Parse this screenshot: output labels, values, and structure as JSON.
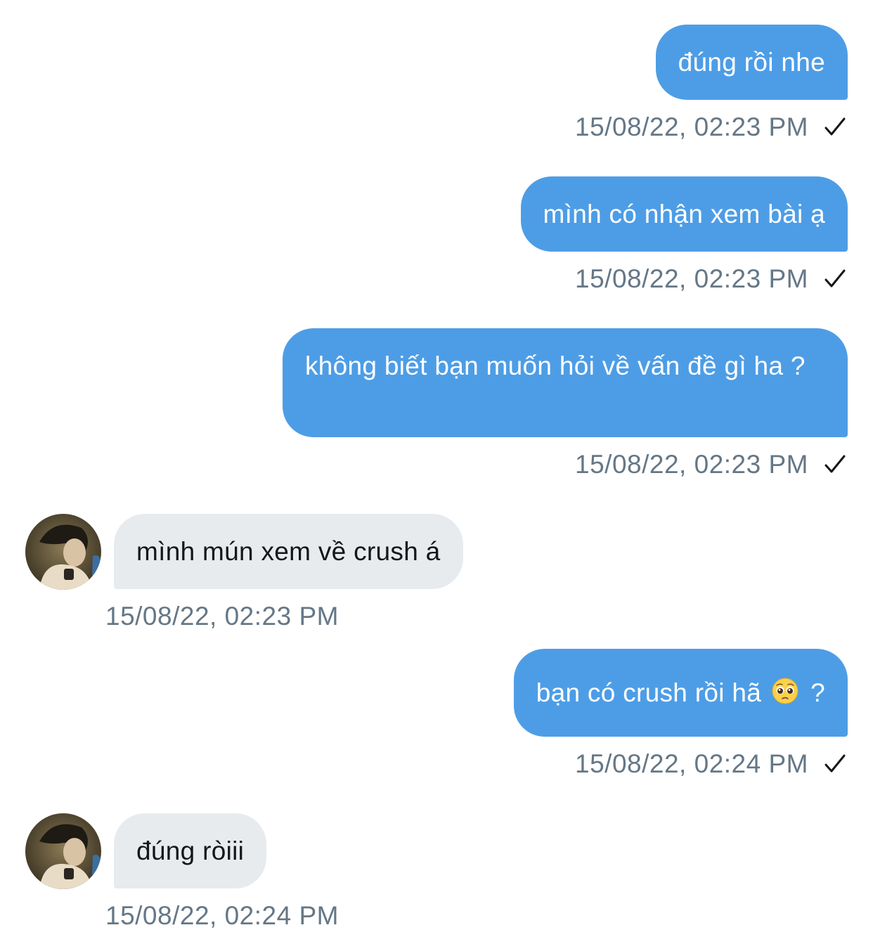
{
  "messages": [
    {
      "direction": "outgoing",
      "text": "đúng rồi nhe",
      "time": "15/08/22, 02:23 PM",
      "status": "sent"
    },
    {
      "direction": "outgoing",
      "text": "mình có nhận xem bài ạ",
      "time": "15/08/22, 02:23 PM",
      "status": "sent"
    },
    {
      "direction": "outgoing",
      "text": "không biết bạn muốn hỏi về vấn đề gì ha ?",
      "time": "15/08/22, 02:23 PM",
      "status": "sent"
    },
    {
      "direction": "incoming",
      "text": "mình mún xem về crush á",
      "time": "15/08/22, 02:23 PM"
    },
    {
      "direction": "outgoing",
      "text_before": "bạn có crush rồi hã",
      "emoji": "pleading-face",
      "text_after": "?",
      "time": "15/08/22, 02:24 PM",
      "status": "sent"
    },
    {
      "direction": "incoming",
      "text": "đúng ròiii",
      "time": "15/08/22, 02:24 PM"
    }
  ],
  "colors": {
    "outgoing_bubble": "#4d9de6",
    "incoming_bubble": "#e7ebee",
    "timestamp": "#657786",
    "incoming_text": "#14171a"
  }
}
